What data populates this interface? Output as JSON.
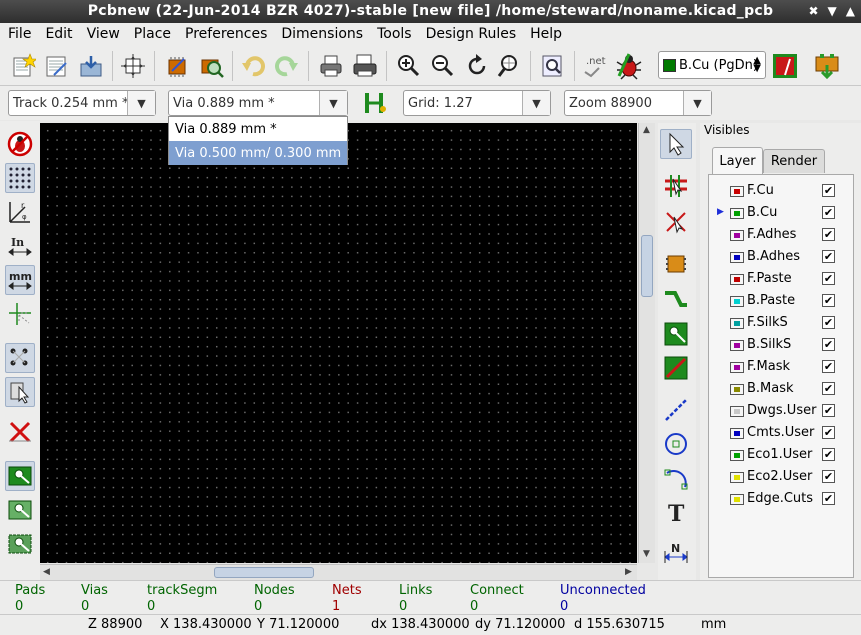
{
  "window": {
    "title": "Pcbnew (22-Jun-2014 BZR 4027)-stable  [new file] /home/steward/noname.kicad_pcb",
    "buttons": [
      "✖",
      "▼",
      "▲"
    ]
  },
  "menu": [
    "File",
    "Edit",
    "View",
    "Place",
    "Preferences",
    "Dimensions",
    "Tools",
    "Design Rules",
    "Help"
  ],
  "toolbar1": {
    "icons": [
      "new-board-icon",
      "open-board-icon",
      "save-icon",
      "page-settings-icon",
      "module-editor-icon",
      "module-viewer-icon",
      "undo-icon",
      "redo-icon",
      "print-icon",
      "plot-icon",
      "zoom-in-icon",
      "zoom-out-icon",
      "redraw-icon",
      "zoom-fit-icon",
      "find-icon",
      "netlist-icon",
      "drc-icon",
      "layer-pair-icon",
      "autoplace-icon"
    ],
    "net_label": ".net",
    "layer_select": {
      "value": "Cu (PgDn)",
      "label_prefix": "B.",
      "color": "#007a00"
    }
  },
  "toolbar2": {
    "track": "Track 0.254 mm *",
    "via": "Via 0.889 mm *",
    "grid": "Grid: 1.27",
    "zoom": "Zoom 88900"
  },
  "via_dropdown": {
    "options": [
      "Via 0.889 mm *",
      "Via 0.500 mm/ 0.300 mm"
    ],
    "highlighted_index": 1
  },
  "left_toolbar": [
    "drc-off-icon",
    "grid-icon",
    "polar-coords-icon",
    "units-inch-icon",
    "units-mm-icon",
    "cursor-shape-icon",
    "ratsnest-icon",
    "module-ratsnest-icon",
    "delete-track-icon",
    "zone-fill-icon",
    "zone-outline-icon",
    "zone-sketch-icon"
  ],
  "right_toolbar": [
    "select-arrow-icon",
    "highlight-net-icon",
    "local-ratsnest-icon",
    "add-module-icon",
    "add-track-icon",
    "add-zone-icon",
    "add-keepout-icon",
    "add-line-icon",
    "add-circle-icon",
    "add-arc-icon",
    "add-text-icon",
    "add-dimension-icon"
  ],
  "visibles": {
    "title": "Visibles",
    "tabs": [
      "Layer",
      "Render"
    ],
    "active_tab": "Layer",
    "layers": [
      {
        "name": "F.Cu",
        "color": "#c80000",
        "checked": true,
        "active": false
      },
      {
        "name": "B.Cu",
        "color": "#00a000",
        "checked": true,
        "active": true
      },
      {
        "name": "F.Adhes",
        "color": "#a000a0",
        "checked": true,
        "active": false
      },
      {
        "name": "B.Adhes",
        "color": "#0000c0",
        "checked": true,
        "active": false
      },
      {
        "name": "F.Paste",
        "color": "#c00000",
        "checked": true,
        "active": false
      },
      {
        "name": "B.Paste",
        "color": "#00d0d0",
        "checked": true,
        "active": false
      },
      {
        "name": "F.SilkS",
        "color": "#00a0a0",
        "checked": true,
        "active": false
      },
      {
        "name": "B.SilkS",
        "color": "#a000a0",
        "checked": true,
        "active": false
      },
      {
        "name": "F.Mask",
        "color": "#a000a0",
        "checked": true,
        "active": false
      },
      {
        "name": "B.Mask",
        "color": "#8a8a00",
        "checked": true,
        "active": false
      },
      {
        "name": "Dwgs.User",
        "color": "#c8c8c8",
        "checked": true,
        "active": false
      },
      {
        "name": "Cmts.User",
        "color": "#0000c0",
        "checked": true,
        "active": false
      },
      {
        "name": "Eco1.User",
        "color": "#00a000",
        "checked": true,
        "active": false
      },
      {
        "name": "Eco2.User",
        "color": "#e0e000",
        "checked": true,
        "active": false
      },
      {
        "name": "Edge.Cuts",
        "color": "#e0e000",
        "checked": true,
        "active": false
      }
    ]
  },
  "status": {
    "stats": [
      {
        "label": "Pads",
        "value": "0",
        "color": "#006400"
      },
      {
        "label": "Vias",
        "value": "0",
        "color": "#006400"
      },
      {
        "label": "trackSegm",
        "value": "0",
        "color": "#006400"
      },
      {
        "label": "Nodes",
        "value": "0",
        "color": "#006400"
      },
      {
        "label": "Nets",
        "value": "1",
        "color": "#a00000"
      },
      {
        "label": "Links",
        "value": "0",
        "color": "#006400"
      },
      {
        "label": "Connect",
        "value": "0",
        "color": "#006400"
      },
      {
        "label": "Unconnected",
        "value": "0",
        "color": "#0000a0"
      }
    ],
    "zoom": "Z 88900",
    "x": "X 138.430000",
    "y": "Y 71.120000",
    "dx": "dx 138.430000",
    "dy": "dy 71.120000",
    "d": "d 155.630715",
    "units": "mm"
  }
}
